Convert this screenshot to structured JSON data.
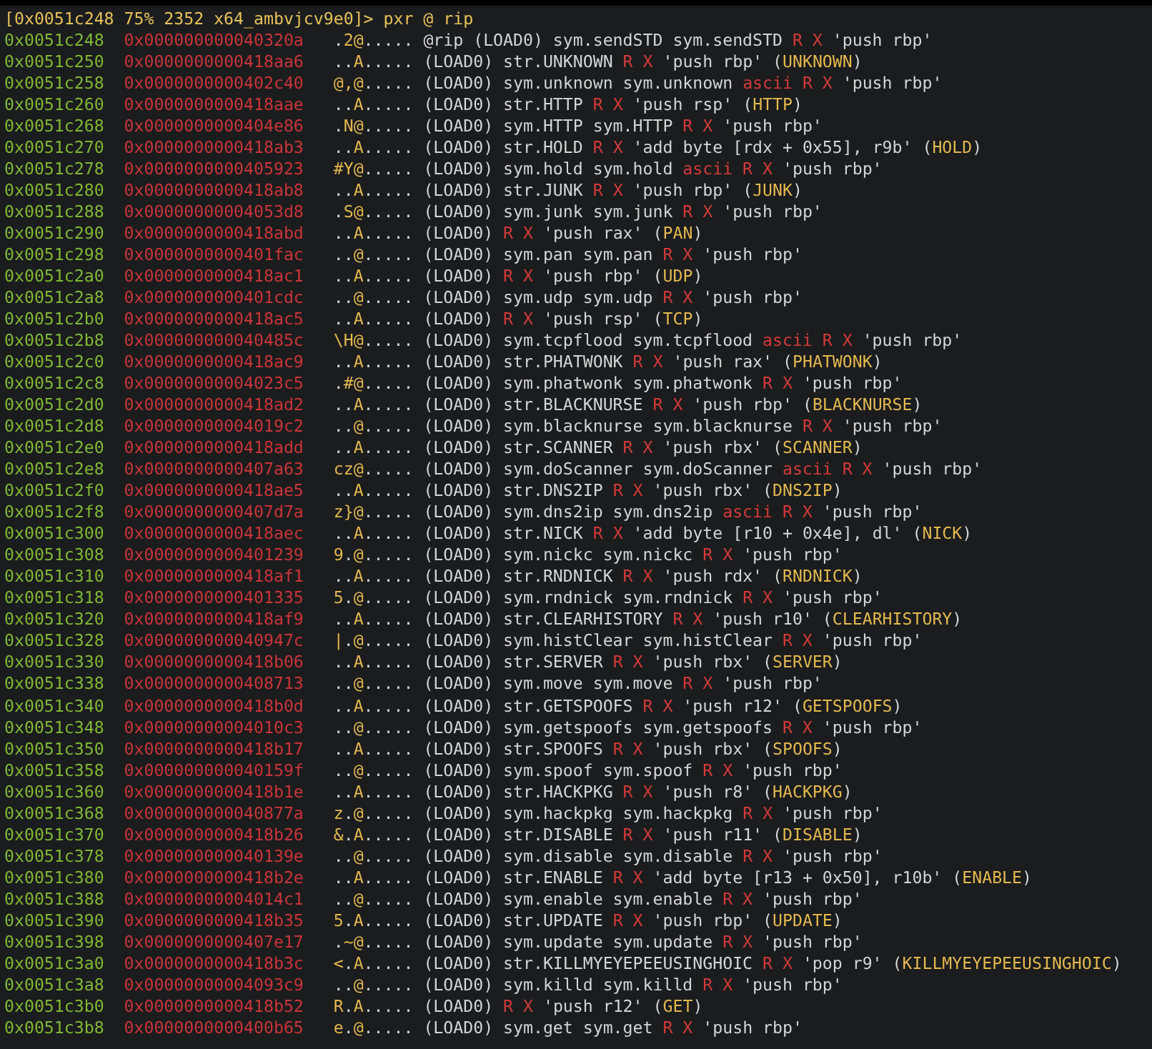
{
  "prompt": "[0x0051c248 75% 2352 x64_ambvjcv9e0]> pxr @ rip",
  "rows": [
    {
      "address": "0x0051c248",
      "value": "0x000000000040320a",
      "ascii": ".2@.....",
      "info": [
        {
          "kind": "text",
          "text": "@rip (LOAD0) sym.sendSTD sym.sendSTD "
        },
        {
          "kind": "perm",
          "text": "R X"
        },
        {
          "kind": "text",
          "text": " 'push rbp'"
        }
      ]
    },
    {
      "address": "0x0051c250",
      "value": "0x0000000000418aa6",
      "ascii": "..A.....",
      "info": [
        {
          "kind": "text",
          "text": "(LOAD0) str.UNKNOWN "
        },
        {
          "kind": "perm",
          "text": "R X"
        },
        {
          "kind": "text",
          "text": " 'push rbp' ("
        },
        {
          "kind": "string",
          "text": "UNKNOWN"
        },
        {
          "kind": "text",
          "text": ")"
        }
      ]
    },
    {
      "address": "0x0051c258",
      "value": "0x0000000000402c40",
      "ascii": "@,@.....",
      "info": [
        {
          "kind": "text",
          "text": "(LOAD0) sym.unknown sym.unknown "
        },
        {
          "kind": "perm",
          "text": "ascii R X"
        },
        {
          "kind": "text",
          "text": " 'push rbp'"
        }
      ]
    },
    {
      "address": "0x0051c260",
      "value": "0x0000000000418aae",
      "ascii": "..A.....",
      "info": [
        {
          "kind": "text",
          "text": "(LOAD0) str.HTTP "
        },
        {
          "kind": "perm",
          "text": "R X"
        },
        {
          "kind": "text",
          "text": " 'push rsp' ("
        },
        {
          "kind": "string",
          "text": "HTTP"
        },
        {
          "kind": "text",
          "text": ")"
        }
      ]
    },
    {
      "address": "0x0051c268",
      "value": "0x0000000000404e86",
      "ascii": ".N@.....",
      "info": [
        {
          "kind": "text",
          "text": "(LOAD0) sym.HTTP sym.HTTP "
        },
        {
          "kind": "perm",
          "text": "R X"
        },
        {
          "kind": "text",
          "text": " 'push rbp'"
        }
      ]
    },
    {
      "address": "0x0051c270",
      "value": "0x0000000000418ab3",
      "ascii": "..A.....",
      "info": [
        {
          "kind": "text",
          "text": "(LOAD0) str.HOLD "
        },
        {
          "kind": "perm",
          "text": "R X"
        },
        {
          "kind": "text",
          "text": " 'add byte [rdx + 0x55], r9b' ("
        },
        {
          "kind": "string",
          "text": "HOLD"
        },
        {
          "kind": "text",
          "text": ")"
        }
      ]
    },
    {
      "address": "0x0051c278",
      "value": "0x0000000000405923",
      "ascii": "#Y@.....",
      "info": [
        {
          "kind": "text",
          "text": "(LOAD0) sym.hold sym.hold "
        },
        {
          "kind": "perm",
          "text": "ascii R X"
        },
        {
          "kind": "text",
          "text": " 'push rbp'"
        }
      ]
    },
    {
      "address": "0x0051c280",
      "value": "0x0000000000418ab8",
      "ascii": "..A.....",
      "info": [
        {
          "kind": "text",
          "text": "(LOAD0) str.JUNK "
        },
        {
          "kind": "perm",
          "text": "R X"
        },
        {
          "kind": "text",
          "text": " 'push rbp' ("
        },
        {
          "kind": "string",
          "text": "JUNK"
        },
        {
          "kind": "text",
          "text": ")"
        }
      ]
    },
    {
      "address": "0x0051c288",
      "value": "0x00000000004053d8",
      "ascii": ".S@.....",
      "info": [
        {
          "kind": "text",
          "text": "(LOAD0) sym.junk sym.junk "
        },
        {
          "kind": "perm",
          "text": "R X"
        },
        {
          "kind": "text",
          "text": " 'push rbp'"
        }
      ]
    },
    {
      "address": "0x0051c290",
      "value": "0x0000000000418abd",
      "ascii": "..A.....",
      "info": [
        {
          "kind": "text",
          "text": "(LOAD0) "
        },
        {
          "kind": "perm",
          "text": "R X"
        },
        {
          "kind": "text",
          "text": " 'push rax' ("
        },
        {
          "kind": "string",
          "text": "PAN"
        },
        {
          "kind": "text",
          "text": ")"
        }
      ]
    },
    {
      "address": "0x0051c298",
      "value": "0x0000000000401fac",
      "ascii": "..@.....",
      "info": [
        {
          "kind": "text",
          "text": "(LOAD0) sym.pan sym.pan "
        },
        {
          "kind": "perm",
          "text": "R X"
        },
        {
          "kind": "text",
          "text": " 'push rbp'"
        }
      ]
    },
    {
      "address": "0x0051c2a0",
      "value": "0x0000000000418ac1",
      "ascii": "..A.....",
      "info": [
        {
          "kind": "text",
          "text": "(LOAD0) "
        },
        {
          "kind": "perm",
          "text": "R X"
        },
        {
          "kind": "text",
          "text": " 'push rbp' ("
        },
        {
          "kind": "string",
          "text": "UDP"
        },
        {
          "kind": "text",
          "text": ")"
        }
      ]
    },
    {
      "address": "0x0051c2a8",
      "value": "0x0000000000401cdc",
      "ascii": "..@.....",
      "info": [
        {
          "kind": "text",
          "text": "(LOAD0) sym.udp sym.udp "
        },
        {
          "kind": "perm",
          "text": "R X"
        },
        {
          "kind": "text",
          "text": " 'push rbp'"
        }
      ]
    },
    {
      "address": "0x0051c2b0",
      "value": "0x0000000000418ac5",
      "ascii": "..A.....",
      "info": [
        {
          "kind": "text",
          "text": "(LOAD0) "
        },
        {
          "kind": "perm",
          "text": "R X"
        },
        {
          "kind": "text",
          "text": " 'push rsp' ("
        },
        {
          "kind": "string",
          "text": "TCP"
        },
        {
          "kind": "text",
          "text": ")"
        }
      ]
    },
    {
      "address": "0x0051c2b8",
      "value": "0x000000000040485c",
      "ascii": "\\H@.....",
      "info": [
        {
          "kind": "text",
          "text": "(LOAD0) sym.tcpflood sym.tcpflood "
        },
        {
          "kind": "perm",
          "text": "ascii R X"
        },
        {
          "kind": "text",
          "text": " 'push rbp'"
        }
      ]
    },
    {
      "address": "0x0051c2c0",
      "value": "0x0000000000418ac9",
      "ascii": "..A.....",
      "info": [
        {
          "kind": "text",
          "text": "(LOAD0) str.PHATWONK "
        },
        {
          "kind": "perm",
          "text": "R X"
        },
        {
          "kind": "text",
          "text": " 'push rax' ("
        },
        {
          "kind": "string",
          "text": "PHATWONK"
        },
        {
          "kind": "text",
          "text": ")"
        }
      ]
    },
    {
      "address": "0x0051c2c8",
      "value": "0x00000000004023c5",
      "ascii": ".#@.....",
      "info": [
        {
          "kind": "text",
          "text": "(LOAD0) sym.phatwonk sym.phatwonk "
        },
        {
          "kind": "perm",
          "text": "R X"
        },
        {
          "kind": "text",
          "text": " 'push rbp'"
        }
      ]
    },
    {
      "address": "0x0051c2d0",
      "value": "0x0000000000418ad2",
      "ascii": "..A.....",
      "info": [
        {
          "kind": "text",
          "text": "(LOAD0) str.BLACKNURSE "
        },
        {
          "kind": "perm",
          "text": "R X"
        },
        {
          "kind": "text",
          "text": " 'push rbp' ("
        },
        {
          "kind": "string",
          "text": "BLACKNURSE"
        },
        {
          "kind": "text",
          "text": ")"
        }
      ]
    },
    {
      "address": "0x0051c2d8",
      "value": "0x00000000004019c2",
      "ascii": "..@.....",
      "info": [
        {
          "kind": "text",
          "text": "(LOAD0) sym.blacknurse sym.blacknurse "
        },
        {
          "kind": "perm",
          "text": "R X"
        },
        {
          "kind": "text",
          "text": " 'push rbp'"
        }
      ]
    },
    {
      "address": "0x0051c2e0",
      "value": "0x0000000000418add",
      "ascii": "..A.....",
      "info": [
        {
          "kind": "text",
          "text": "(LOAD0) str.SCANNER "
        },
        {
          "kind": "perm",
          "text": "R X"
        },
        {
          "kind": "text",
          "text": " 'push rbx' ("
        },
        {
          "kind": "string",
          "text": "SCANNER"
        },
        {
          "kind": "text",
          "text": ")"
        }
      ]
    },
    {
      "address": "0x0051c2e8",
      "value": "0x0000000000407a63",
      "ascii": "cz@.....",
      "info": [
        {
          "kind": "text",
          "text": "(LOAD0) sym.doScanner sym.doScanner "
        },
        {
          "kind": "perm",
          "text": "ascii R X"
        },
        {
          "kind": "text",
          "text": " 'push rbp'"
        }
      ]
    },
    {
      "address": "0x0051c2f0",
      "value": "0x0000000000418ae5",
      "ascii": "..A.....",
      "info": [
        {
          "kind": "text",
          "text": "(LOAD0) str.DNS2IP "
        },
        {
          "kind": "perm",
          "text": "R X"
        },
        {
          "kind": "text",
          "text": " 'push rbx' ("
        },
        {
          "kind": "string",
          "text": "DNS2IP"
        },
        {
          "kind": "text",
          "text": ")"
        }
      ]
    },
    {
      "address": "0x0051c2f8",
      "value": "0x0000000000407d7a",
      "ascii": "z}@.....",
      "info": [
        {
          "kind": "text",
          "text": "(LOAD0) sym.dns2ip sym.dns2ip "
        },
        {
          "kind": "perm",
          "text": "ascii R X"
        },
        {
          "kind": "text",
          "text": " 'push rbp'"
        }
      ]
    },
    {
      "address": "0x0051c300",
      "value": "0x0000000000418aec",
      "ascii": "..A.....",
      "info": [
        {
          "kind": "text",
          "text": "(LOAD0) str.NICK "
        },
        {
          "kind": "perm",
          "text": "R X"
        },
        {
          "kind": "text",
          "text": " 'add byte [r10 + 0x4e], dl' ("
        },
        {
          "kind": "string",
          "text": "NICK"
        },
        {
          "kind": "text",
          "text": ")"
        }
      ]
    },
    {
      "address": "0x0051c308",
      "value": "0x0000000000401239",
      "ascii": "9.@.....",
      "info": [
        {
          "kind": "text",
          "text": "(LOAD0) sym.nickc sym.nickc "
        },
        {
          "kind": "perm",
          "text": "R X"
        },
        {
          "kind": "text",
          "text": " 'push rbp'"
        }
      ]
    },
    {
      "address": "0x0051c310",
      "value": "0x0000000000418af1",
      "ascii": "..A.....",
      "info": [
        {
          "kind": "text",
          "text": "(LOAD0) str.RNDNICK "
        },
        {
          "kind": "perm",
          "text": "R X"
        },
        {
          "kind": "text",
          "text": " 'push rdx' ("
        },
        {
          "kind": "string",
          "text": "RNDNICK"
        },
        {
          "kind": "text",
          "text": ")"
        }
      ]
    },
    {
      "address": "0x0051c318",
      "value": "0x0000000000401335",
      "ascii": "5.@.....",
      "info": [
        {
          "kind": "text",
          "text": "(LOAD0) sym.rndnick sym.rndnick "
        },
        {
          "kind": "perm",
          "text": "R X"
        },
        {
          "kind": "text",
          "text": " 'push rbp'"
        }
      ]
    },
    {
      "address": "0x0051c320",
      "value": "0x0000000000418af9",
      "ascii": "..A.....",
      "info": [
        {
          "kind": "text",
          "text": "(LOAD0) str.CLEARHISTORY "
        },
        {
          "kind": "perm",
          "text": "R X"
        },
        {
          "kind": "text",
          "text": " 'push r10' ("
        },
        {
          "kind": "string",
          "text": "CLEARHISTORY"
        },
        {
          "kind": "text",
          "text": ")"
        }
      ]
    },
    {
      "address": "0x0051c328",
      "value": "0x000000000040947c",
      "ascii": "|.@.....",
      "info": [
        {
          "kind": "text",
          "text": "(LOAD0) sym.histClear sym.histClear "
        },
        {
          "kind": "perm",
          "text": "R X"
        },
        {
          "kind": "text",
          "text": " 'push rbp'"
        }
      ]
    },
    {
      "address": "0x0051c330",
      "value": "0x0000000000418b06",
      "ascii": "..A.....",
      "info": [
        {
          "kind": "text",
          "text": "(LOAD0) str.SERVER "
        },
        {
          "kind": "perm",
          "text": "R X"
        },
        {
          "kind": "text",
          "text": " 'push rbx' ("
        },
        {
          "kind": "string",
          "text": "SERVER"
        },
        {
          "kind": "text",
          "text": ")"
        }
      ]
    },
    {
      "address": "0x0051c338",
      "value": "0x0000000000408713",
      "ascii": "..@.....",
      "info": [
        {
          "kind": "text",
          "text": "(LOAD0) sym.move sym.move "
        },
        {
          "kind": "perm",
          "text": "R X"
        },
        {
          "kind": "text",
          "text": " 'push rbp'"
        }
      ]
    },
    {
      "address": "0x0051c340",
      "value": "0x0000000000418b0d",
      "ascii": "..A.....",
      "info": [
        {
          "kind": "text",
          "text": "(LOAD0) str.GETSPOOFS "
        },
        {
          "kind": "perm",
          "text": "R X"
        },
        {
          "kind": "text",
          "text": " 'push r12' ("
        },
        {
          "kind": "string",
          "text": "GETSPOOFS"
        },
        {
          "kind": "text",
          "text": ")"
        }
      ]
    },
    {
      "address": "0x0051c348",
      "value": "0x00000000004010c3",
      "ascii": "..@.....",
      "info": [
        {
          "kind": "text",
          "text": "(LOAD0) sym.getspoofs sym.getspoofs "
        },
        {
          "kind": "perm",
          "text": "R X"
        },
        {
          "kind": "text",
          "text": " 'push rbp'"
        }
      ]
    },
    {
      "address": "0x0051c350",
      "value": "0x0000000000418b17",
      "ascii": "..A.....",
      "info": [
        {
          "kind": "text",
          "text": "(LOAD0) str.SPOOFS "
        },
        {
          "kind": "perm",
          "text": "R X"
        },
        {
          "kind": "text",
          "text": " 'push rbx' ("
        },
        {
          "kind": "string",
          "text": "SPOOFS"
        },
        {
          "kind": "text",
          "text": ")"
        }
      ]
    },
    {
      "address": "0x0051c358",
      "value": "0x000000000040159f",
      "ascii": "..@.....",
      "info": [
        {
          "kind": "text",
          "text": "(LOAD0) sym.spoof sym.spoof "
        },
        {
          "kind": "perm",
          "text": "R X"
        },
        {
          "kind": "text",
          "text": " 'push rbp'"
        }
      ]
    },
    {
      "address": "0x0051c360",
      "value": "0x0000000000418b1e",
      "ascii": "..A.....",
      "info": [
        {
          "kind": "text",
          "text": "(LOAD0) str.HACKPKG "
        },
        {
          "kind": "perm",
          "text": "R X"
        },
        {
          "kind": "text",
          "text": " 'push r8' ("
        },
        {
          "kind": "string",
          "text": "HACKPKG"
        },
        {
          "kind": "text",
          "text": ")"
        }
      ]
    },
    {
      "address": "0x0051c368",
      "value": "0x000000000040877a",
      "ascii": "z.@.....",
      "info": [
        {
          "kind": "text",
          "text": "(LOAD0) sym.hackpkg sym.hackpkg "
        },
        {
          "kind": "perm",
          "text": "R X"
        },
        {
          "kind": "text",
          "text": " 'push rbp'"
        }
      ]
    },
    {
      "address": "0x0051c370",
      "value": "0x0000000000418b26",
      "ascii": "&.A.....",
      "info": [
        {
          "kind": "text",
          "text": "(LOAD0) str.DISABLE "
        },
        {
          "kind": "perm",
          "text": "R X"
        },
        {
          "kind": "text",
          "text": " 'push r11' ("
        },
        {
          "kind": "string",
          "text": "DISABLE"
        },
        {
          "kind": "text",
          "text": ")"
        }
      ]
    },
    {
      "address": "0x0051c378",
      "value": "0x000000000040139e",
      "ascii": "..@.....",
      "info": [
        {
          "kind": "text",
          "text": "(LOAD0) sym.disable sym.disable "
        },
        {
          "kind": "perm",
          "text": "R X"
        },
        {
          "kind": "text",
          "text": " 'push rbp'"
        }
      ]
    },
    {
      "address": "0x0051c380",
      "value": "0x0000000000418b2e",
      "ascii": "..A.....",
      "info": [
        {
          "kind": "text",
          "text": "(LOAD0) str.ENABLE "
        },
        {
          "kind": "perm",
          "text": "R X"
        },
        {
          "kind": "text",
          "text": " 'add byte [r13 + 0x50], r10b' ("
        },
        {
          "kind": "string",
          "text": "ENABLE"
        },
        {
          "kind": "text",
          "text": ")"
        }
      ]
    },
    {
      "address": "0x0051c388",
      "value": "0x00000000004014c1",
      "ascii": "..@.....",
      "info": [
        {
          "kind": "text",
          "text": "(LOAD0) sym.enable sym.enable "
        },
        {
          "kind": "perm",
          "text": "R X"
        },
        {
          "kind": "text",
          "text": " 'push rbp'"
        }
      ]
    },
    {
      "address": "0x0051c390",
      "value": "0x0000000000418b35",
      "ascii": "5.A.....",
      "info": [
        {
          "kind": "text",
          "text": "(LOAD0) str.UPDATE "
        },
        {
          "kind": "perm",
          "text": "R X"
        },
        {
          "kind": "text",
          "text": " 'push rbp' ("
        },
        {
          "kind": "string",
          "text": "UPDATE"
        },
        {
          "kind": "text",
          "text": ")"
        }
      ]
    },
    {
      "address": "0x0051c398",
      "value": "0x0000000000407e17",
      "ascii": ".~@.....",
      "info": [
        {
          "kind": "text",
          "text": "(LOAD0) sym.update sym.update "
        },
        {
          "kind": "perm",
          "text": "R X"
        },
        {
          "kind": "text",
          "text": " 'push rbp'"
        }
      ]
    },
    {
      "address": "0x0051c3a0",
      "value": "0x0000000000418b3c",
      "ascii": "<.A.....",
      "info": [
        {
          "kind": "text",
          "text": "(LOAD0) str.KILLMYEYEPEEUSINGHOIC "
        },
        {
          "kind": "perm",
          "text": "R X"
        },
        {
          "kind": "text",
          "text": " 'pop r9' ("
        },
        {
          "kind": "string",
          "text": "KILLMYEYEPEEUSINGHOIC"
        },
        {
          "kind": "text",
          "text": ")"
        }
      ]
    },
    {
      "address": "0x0051c3a8",
      "value": "0x00000000004093c9",
      "ascii": "..@.....",
      "info": [
        {
          "kind": "text",
          "text": "(LOAD0) sym.killd sym.killd "
        },
        {
          "kind": "perm",
          "text": "R X"
        },
        {
          "kind": "text",
          "text": " 'push rbp'"
        }
      ]
    },
    {
      "address": "0x0051c3b0",
      "value": "0x0000000000418b52",
      "ascii": "R.A.....",
      "info": [
        {
          "kind": "text",
          "text": "(LOAD0) "
        },
        {
          "kind": "perm",
          "text": "R X"
        },
        {
          "kind": "text",
          "text": " 'push r12' ("
        },
        {
          "kind": "string",
          "text": "GET"
        },
        {
          "kind": "text",
          "text": ")"
        }
      ]
    },
    {
      "address": "0x0051c3b8",
      "value": "0x0000000000400b65",
      "ascii": "e.@.....",
      "info": [
        {
          "kind": "text",
          "text": "(LOAD0) sym.get sym.get "
        },
        {
          "kind": "perm",
          "text": "R X"
        },
        {
          "kind": "text",
          "text": " 'push rbp'"
        }
      ]
    }
  ]
}
